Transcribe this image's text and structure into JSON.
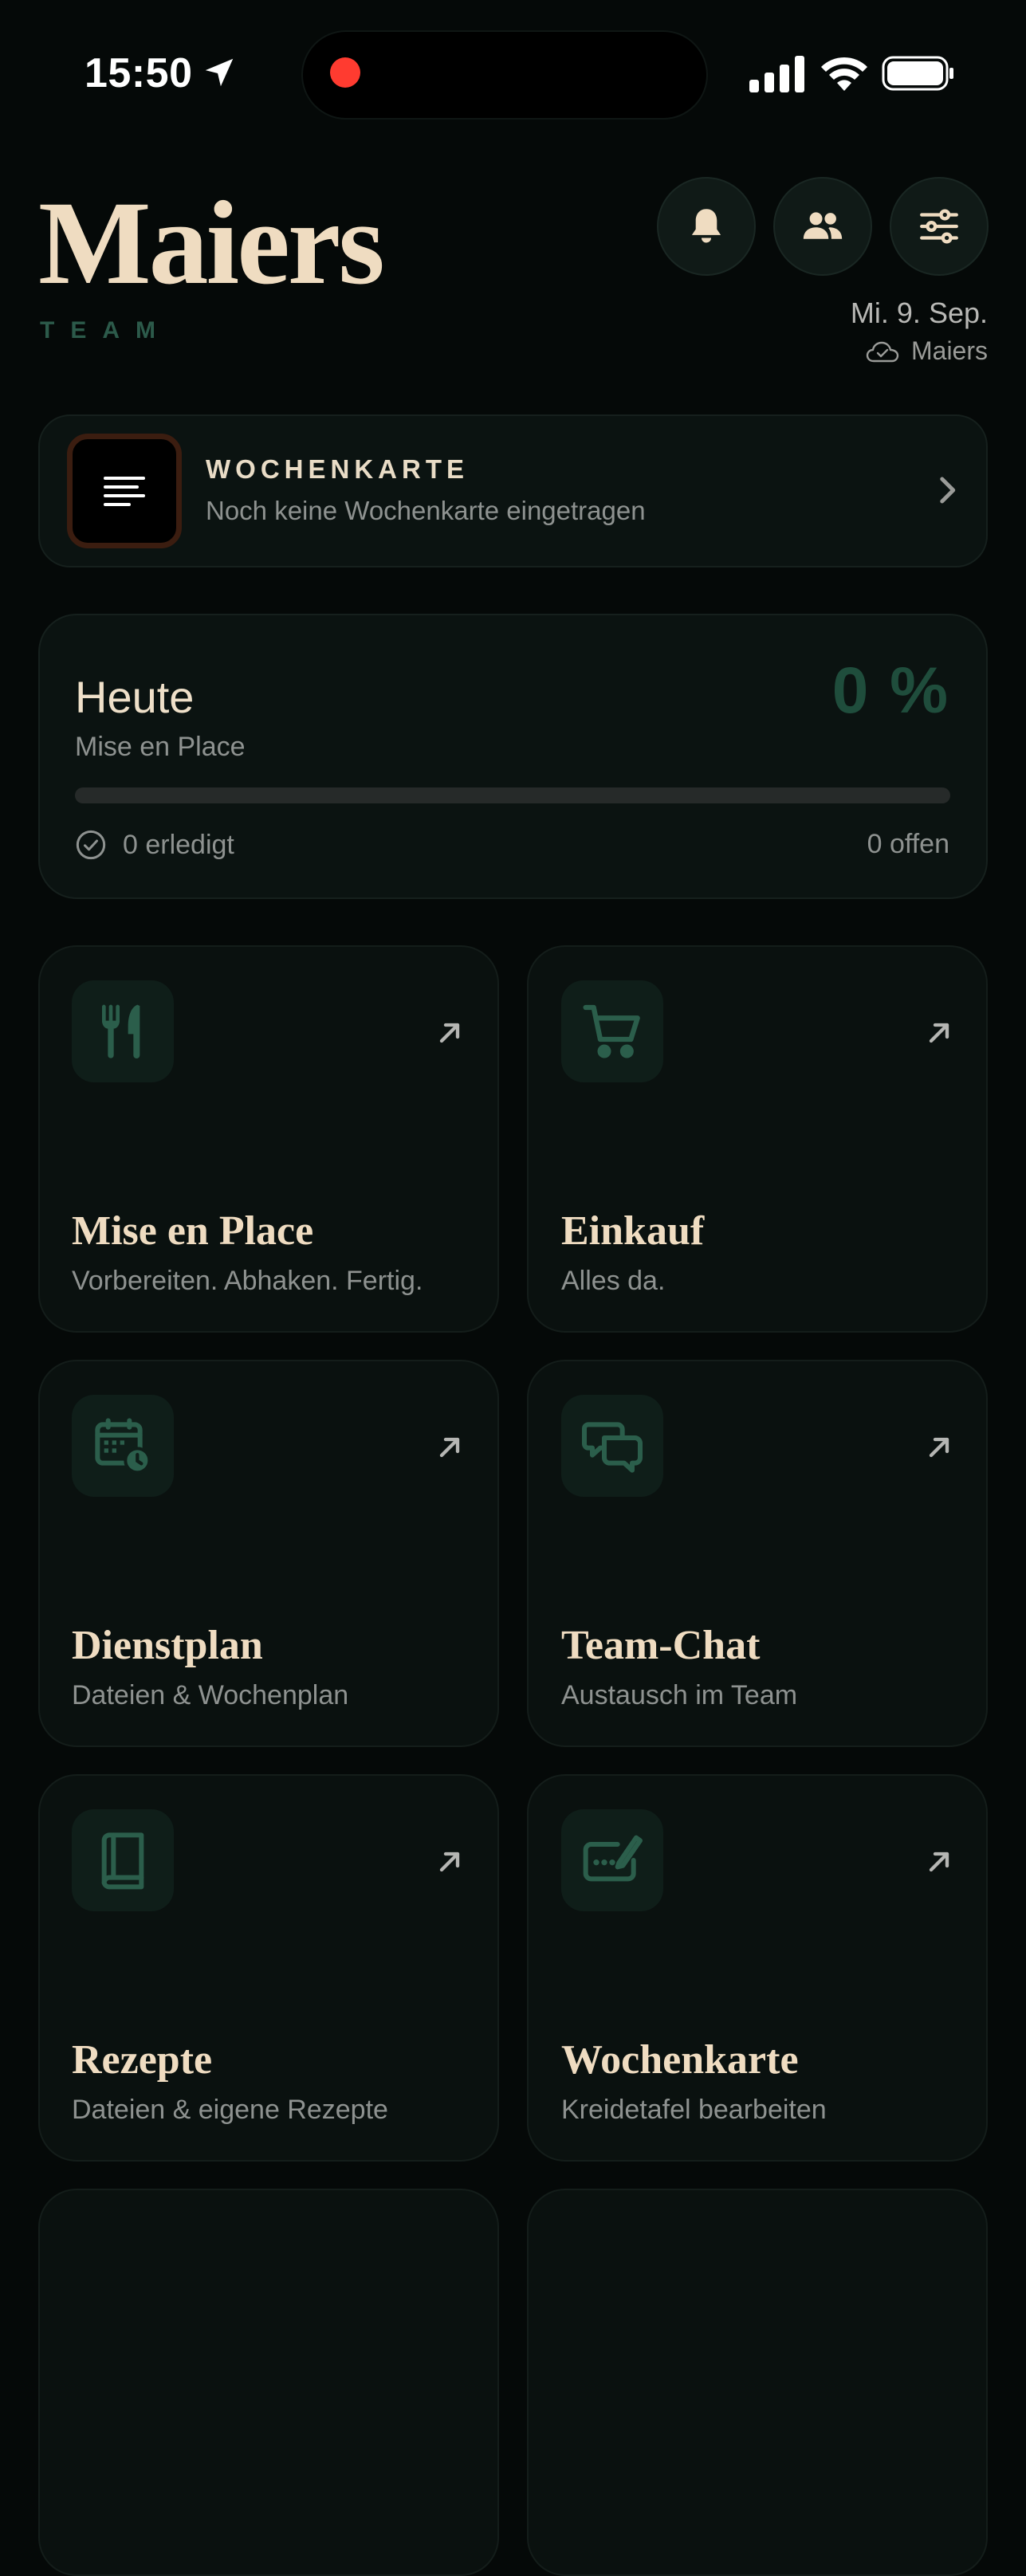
{
  "status_bar": {
    "time": "15:50"
  },
  "header": {
    "brand": "Maiers",
    "brand_sub": "TEAM",
    "date": "Mi. 9. Sep.",
    "sync_label": "Maiers",
    "buttons": [
      "bell-icon",
      "team-icon",
      "sliders-icon"
    ]
  },
  "banner": {
    "title": "WOCHENKARTE",
    "text": "Noch keine Wochenkarte eingetragen"
  },
  "today": {
    "title": "Heute",
    "subtitle": "Mise en Place",
    "percent_label": "0 %",
    "progress": 0,
    "done_label": "0 erledigt",
    "open_label": "0 offen"
  },
  "tiles": [
    {
      "title": "Mise en Place",
      "subtitle": "Vorbereiten. Abhaken. Fertig.",
      "icon": "cutlery-icon"
    },
    {
      "title": "Einkauf",
      "subtitle": "Alles da.",
      "icon": "cart-icon"
    },
    {
      "title": "Dienstplan",
      "subtitle": "Dateien & Wochenplan",
      "icon": "calendar-clock-icon"
    },
    {
      "title": "Team-Chat",
      "subtitle": "Austausch im Team",
      "icon": "chat-icon"
    },
    {
      "title": "Rezepte",
      "subtitle": "Dateien & eigene Rezepte",
      "icon": "book-icon"
    },
    {
      "title": "Wochenkarte",
      "subtitle": "Kreidetafel bearbeiten",
      "icon": "chalkboard-pen-icon"
    }
  ],
  "colors": {
    "accent_green": "#2f7a5b",
    "cream": "#efdcc1",
    "background": "#050908"
  }
}
